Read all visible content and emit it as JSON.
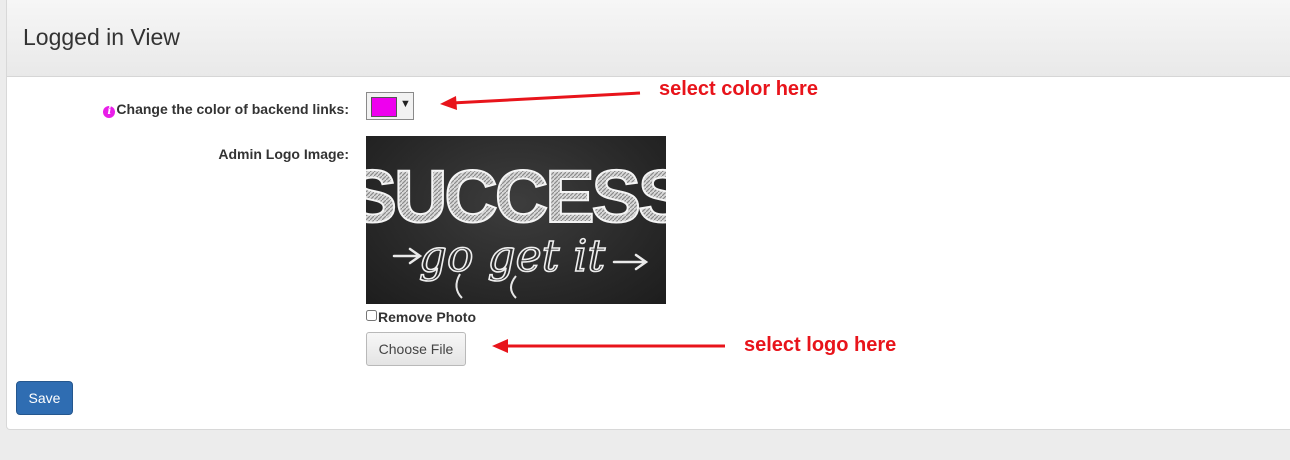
{
  "panel": {
    "title": "Logged in View"
  },
  "form": {
    "color_label": "Change the color of backend links:",
    "color_value": "#ee00ee",
    "logo_label": "Admin Logo Image:",
    "logo_image": {
      "headline": "SUCCESS",
      "subtext": "go get it"
    },
    "remove_photo_label": "Remove Photo",
    "choose_file_label": "Choose File",
    "save_label": "Save"
  },
  "annotations": {
    "color": "select color here",
    "logo": "select logo here",
    "color_hex": "#e8141b"
  },
  "icons": {
    "info": "info-circle-icon",
    "dropdown": "caret-down-icon"
  }
}
